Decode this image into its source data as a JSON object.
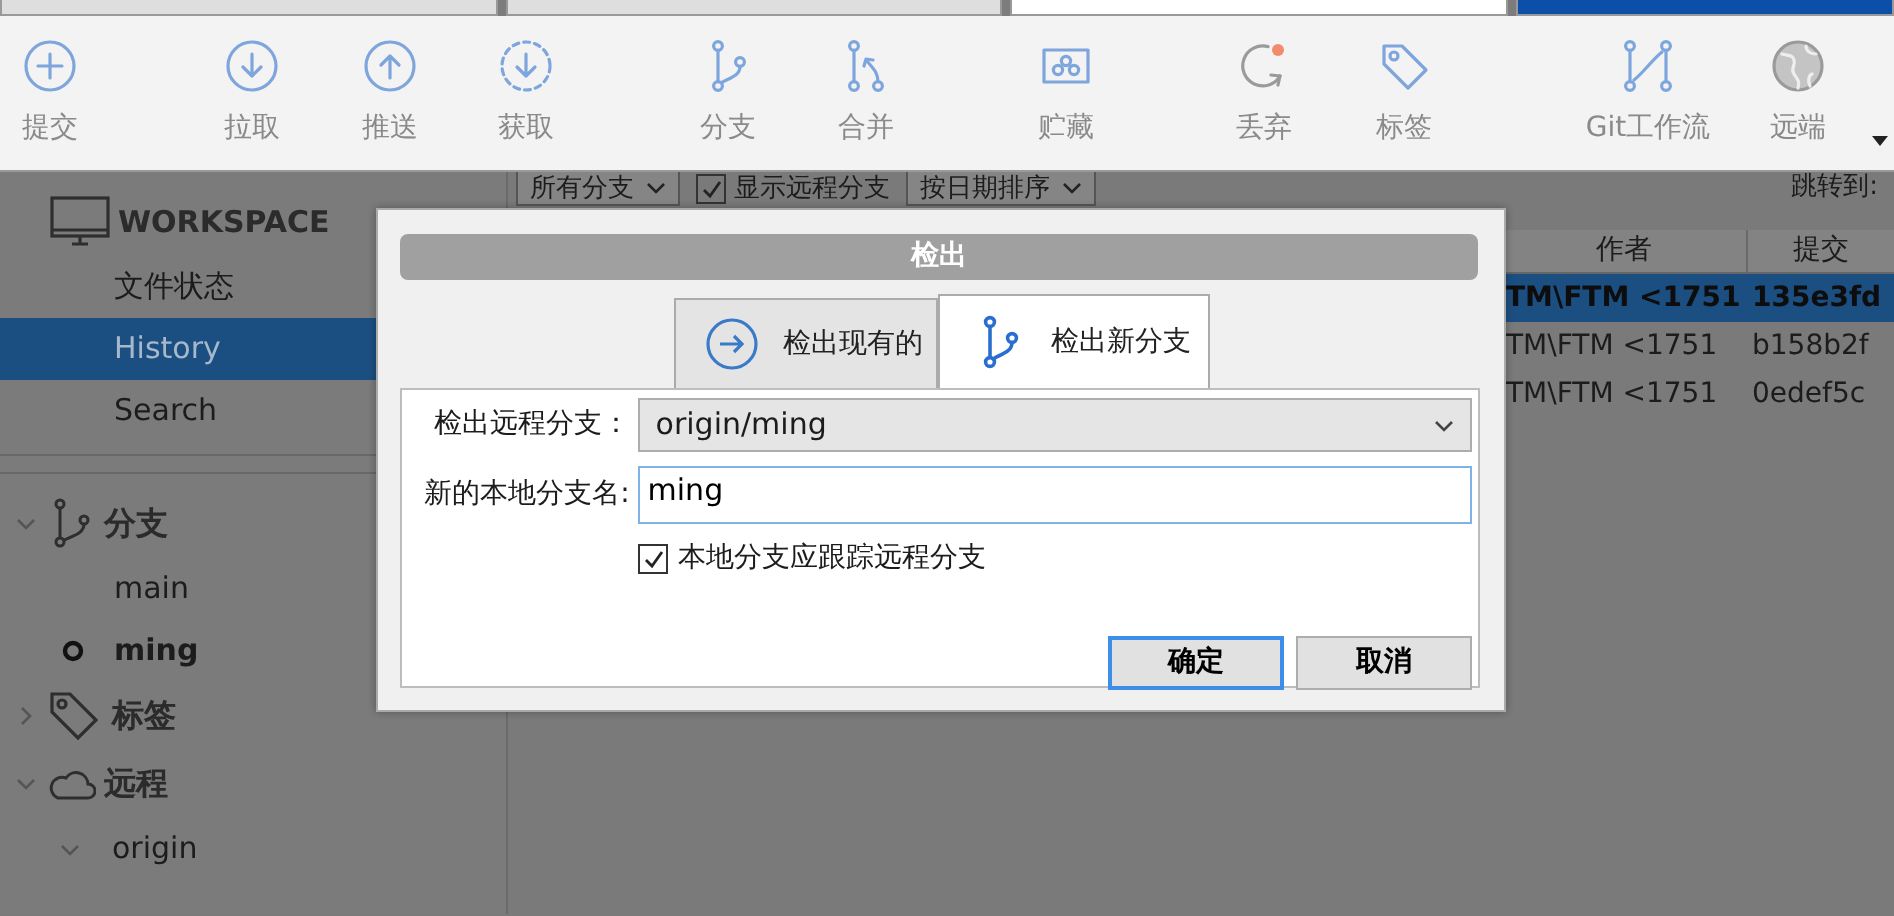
{
  "document_tabs": [
    {
      "selected": false
    },
    {
      "selected": false
    },
    {
      "selected": true
    }
  ],
  "toolbar": {
    "buttons": [
      {
        "label": "提交"
      },
      {
        "label": "拉取"
      },
      {
        "label": "推送"
      },
      {
        "label": "获取"
      },
      {
        "label": "分支"
      },
      {
        "label": "合并"
      },
      {
        "label": "贮藏"
      },
      {
        "label": "丢弃"
      },
      {
        "label": "标签"
      },
      {
        "label": "Git工作流"
      },
      {
        "label": "远端"
      }
    ]
  },
  "sidebar": {
    "sections": [
      {
        "kind": "workspace",
        "title": "WORKSPACE",
        "items": [
          {
            "label": "文件状态",
            "selected": false
          },
          {
            "label": "History",
            "selected": true
          },
          {
            "label": "Search",
            "selected": false
          }
        ]
      },
      {
        "kind": "branches",
        "title": "分支",
        "expanded": true,
        "items": [
          {
            "label": "main",
            "current": false
          },
          {
            "label": "ming",
            "current": true
          }
        ]
      },
      {
        "kind": "tags",
        "title": "标签",
        "expanded": false
      },
      {
        "kind": "remotes",
        "title": "远程",
        "expanded": true,
        "items": [
          {
            "label": "origin",
            "expanded": true
          }
        ]
      }
    ]
  },
  "filter_bar": {
    "branch_filter": "所有分支",
    "show_remote": {
      "label": "显示远程分支",
      "checked": true
    },
    "sort": "按日期排序",
    "jump_label": "跳转到:"
  },
  "table": {
    "columns": [
      "作者",
      "提交"
    ],
    "rows": [
      {
        "author": "TM\\FTM <1751",
        "commit": "135e3fd",
        "selected": true
      },
      {
        "author": "TM\\FTM <1751",
        "commit": "b158b2f",
        "selected": false
      },
      {
        "author": "TM\\FTM <1751",
        "commit": "0edef5c",
        "selected": false
      }
    ]
  },
  "dialog": {
    "title": "检出",
    "tabs": [
      {
        "label": "检出现有的",
        "selected": false
      },
      {
        "label": "检出新分支",
        "selected": true
      }
    ],
    "fields": [
      {
        "kind": "select",
        "label": "检出远程分支：",
        "value": "origin/ming"
      },
      {
        "kind": "text",
        "label": "新的本地分支名:",
        "value": "ming"
      }
    ],
    "track": {
      "label": "本地分支应跟踪远程分支",
      "checked": true
    },
    "buttons": [
      {
        "label": "确定",
        "default": true
      },
      {
        "label": "取消",
        "default": false
      }
    ]
  }
}
